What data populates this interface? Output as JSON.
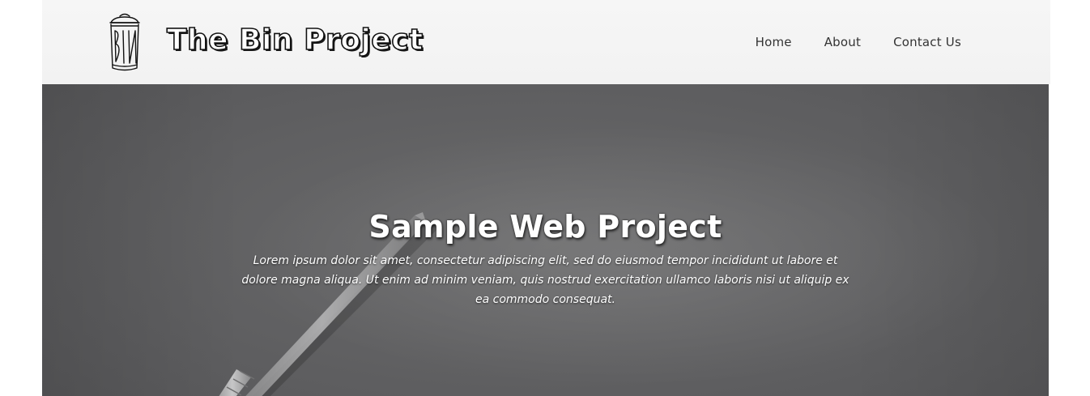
{
  "header": {
    "logo_text": "The Bin Project",
    "logo_icon": "trash-bin-icon",
    "nav": {
      "home": "Home",
      "about": "About",
      "contact": "Contact Us"
    }
  },
  "hero": {
    "title": "Sample Web Project",
    "description": "Lorem ipsum dolor sit amet, consectetur adipiscing elit, sed do eiusmod tempor incididunt ut labore et dolore magna aliqua. Ut enim ad minim veniam, quis nostrud exercitation ullamco laboris nisi ut aliquip ex ea commodo consequat.",
    "background_image": "pencil-on-paper-image"
  }
}
